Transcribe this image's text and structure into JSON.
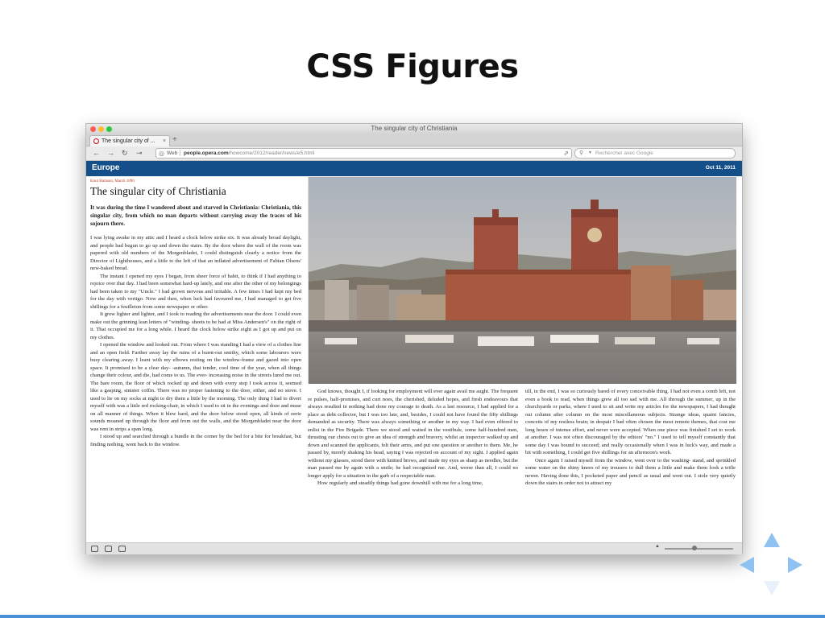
{
  "slide": {
    "title": "CSS Figures",
    "progress": 1.0,
    "accent_color": "#4a90d9"
  },
  "browser": {
    "window_title": "The singular city of Christiania",
    "tab": {
      "label": "The singular city of ...",
      "icon": "opera-icon",
      "close": "×"
    },
    "new_tab": "+",
    "address": {
      "mode": "Web",
      "url_host": "people.opera.com",
      "url_path": "/howcome/2012/reader/news/e5.html"
    },
    "search": {
      "placeholder": "Rechercher avec Google"
    }
  },
  "page": {
    "section": "Europe",
    "date": "Oct 11, 2011",
    "header_color": "#144f8a",
    "kicker": "Knut Hamsun, March 1890",
    "title": "The singular city of Christiania",
    "lede": "It was during the time I wandered about and starved in Christiania: Christiania, this singular city, from which no man departs without carrying away the traces of his sojourn there.",
    "left_paragraphs": [
      "I was lying awake in my attic and I heard a clock below strike six. It was already broad daylight, and people had begun to go up and down the stairs. By the door where the wall of the room was papered with old numbers of the Morgenbladet, I could distinguish clearly a notice from the Director of Lighthouses, and a little to the left of that an inflated advertisement of Fabian Olsens' new-baked bread.",
      "The instant I opened my eyes I began, from sheer force of habit, to think if I had anything to rejoice over that day. I had been somewhat hard-up lately, and one after the other of my belongings had been taken to my \"Uncle.\" I had grown nervous and irritable. A few times I had kept my bed for the day with vertigo. Now and then, when luck had favoured me, I had managed to get five shillings for a feuilleton from some newspaper or other.",
      "It grew lighter and lighter, and I took to reading the advertisements near the door. I could even make out the grinning lean letters of \"winding- sheets to be had at Miss Andersen's\" on the right of it. That occupied me for a long while. I heard the clock below strike eight as I got up and put on my clothes.",
      "I opened the window and looked out. From where I was standing I had a view of a clothes line and an open field. Farther away lay the ruins of a burnt-out smithy, which some labourers were busy clearing away. I leant with my elbows resting on the window-frame and gazed into open space. It promised to be a clear day- -autumn, that tender, cool time of the year, when all things change their colour, and die, had come to us. The ever- increasing noise in the streets lured me out. The bare room, the floor of which rocked up and down with every step I took across it, seemed like a gasping, sinister coffin. There was no proper fastening to the door, either, and no stove. I used to lie on my socks at night to dry them a little by the morning. The only thing I had to divert myself with was a little red rocking-chair, in which I used to sit in the evenings and doze and muse on all manner of things. When it blew hard, and the door below stood open, all kinds of eerie sounds moaned up through the floor and from out the walls, and the Morgenbladet near the door was rent in strips a span long.",
      "I stood up and searched through a bundle in the corner by the bed for a bite for breakfast, but finding nothing, went back to the window."
    ],
    "col2_paragraphs": [
      "God knows, thought I, if looking for employment will ever again avail me aught. The frequent re pulses, half-promises, and curt noes, the cherished, deluded hopes, and fresh endeavours that always resulted in nothing had done my courage to death. As a last resource, I had applied for a place as debt collector, but I was too late, and, besides, I could not have found the fifty shillings demanded as security. There was always something or another in my way. I had even offered to enlist in the Fire Brigade. There we stood and waited in the vestibule, some half-hundred men, thrusting our chests out to give an idea of strength and bravery, whilst an inspector walked up and down and scanned the applicants, felt their arms, and put one question or another to them. Me, he passed by, merely shaking his head, saying I was rejected on account of my sight. I applied again without my glasses, stood there with knitted brows, and made my eyes as sharp as needles, but the man passed me by again with a smile; he had recognized me. And, worse than all, I could no longer apply for a situation in the garb of a respectable man.",
      "How regularly and steadily things had gone downhill with me for a long time,"
    ],
    "col3_paragraphs": [
      "till, in the end, I was so curiously bared of every conceivable thing. I had not even a comb left, not even a book to read, when things grew all too sad with me. All through the summer, up in the churchyards or parks, where I used to sit and write my articles for the newspapers, I had thought out column after column on the most miscellaneous subjects. Strange ideas, quaint fancies, conceits of my restless brain; in despair I had often chosen the most remote themes, that cost me long hours of intense effort, and never were accepted. When one piece was finished I set to work at another. I was not often discouraged by the editors' \"no.\" I used to tell myself constantly that some day I was bound to succeed; and really occasionally when I was in luck's way, and made a bit with something, I could get five shillings for an afternoon's work.",
      "Once again I raised myself from the window, went over to the washing- stand, and sprinkled some water on the shiny knees of my trousers to dull them a little and make them look a trifle newer. Having done this, I pocketed paper and pencil as usual and went out. I stole very quietly down the stairs in order not to attract my"
    ]
  }
}
